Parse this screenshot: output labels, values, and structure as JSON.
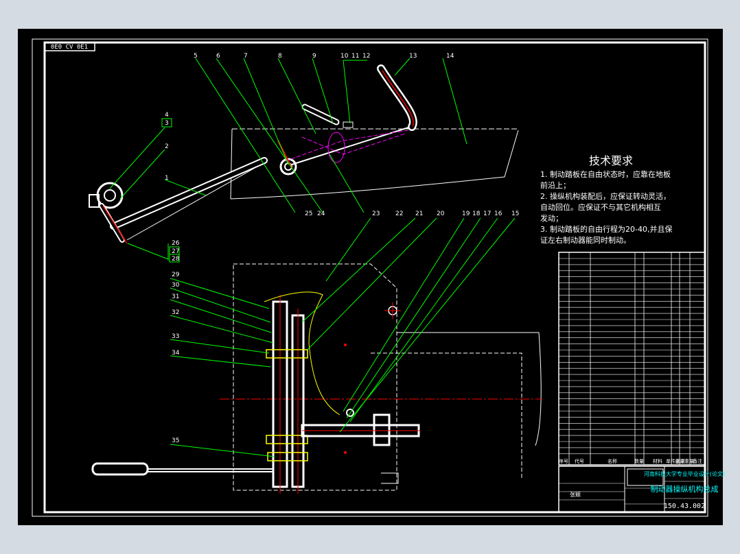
{
  "drawing": {
    "code_stamp": "0E0 CV 0E1",
    "tech_requirements": {
      "title": "技术要求",
      "items": [
        [
          "1.  制动踏板在自由状态时，应靠在地板",
          "    前沿上；"
        ],
        [
          "2.  操纵机构装配后，应保证转动灵活，",
          "    自动回位。应保证不与其它机构相互",
          "    发动；"
        ],
        [
          "3.  制动踏板的自由行程为20-40,并且保",
          "    证左右制动器能同时制动。"
        ]
      ]
    },
    "callouts_top": [
      "1",
      "2",
      "3",
      "4",
      "5",
      "6",
      "7",
      "8",
      "9",
      "10",
      "11",
      "12",
      "13",
      "14",
      "20",
      "21",
      "22",
      "23",
      "24",
      "25",
      "26",
      "27",
      "28",
      "15",
      "16",
      "17",
      "18",
      "19"
    ],
    "callouts_side": [
      "29",
      "30",
      "31",
      "32",
      "33",
      "34",
      "35"
    ],
    "title_block": {
      "school": "河南科技大学专业毕业设计(论文)",
      "drawing_name": "制动器操纵机构总成",
      "drawing_number": "150.43.002",
      "designer": "张颖",
      "bom_header": [
        "序号",
        "代号",
        "名称",
        "数量",
        "材料",
        "单件重量",
        "总计重量",
        "备注"
      ]
    }
  },
  "colors": {
    "background": "#000000",
    "frame": "#ffffff",
    "leader": "#00ff00",
    "centerline": "#ff0000",
    "hidden": "#ff00ff",
    "title_cyan": "#00ffff",
    "viewer_bg": "#d4dbe3"
  }
}
